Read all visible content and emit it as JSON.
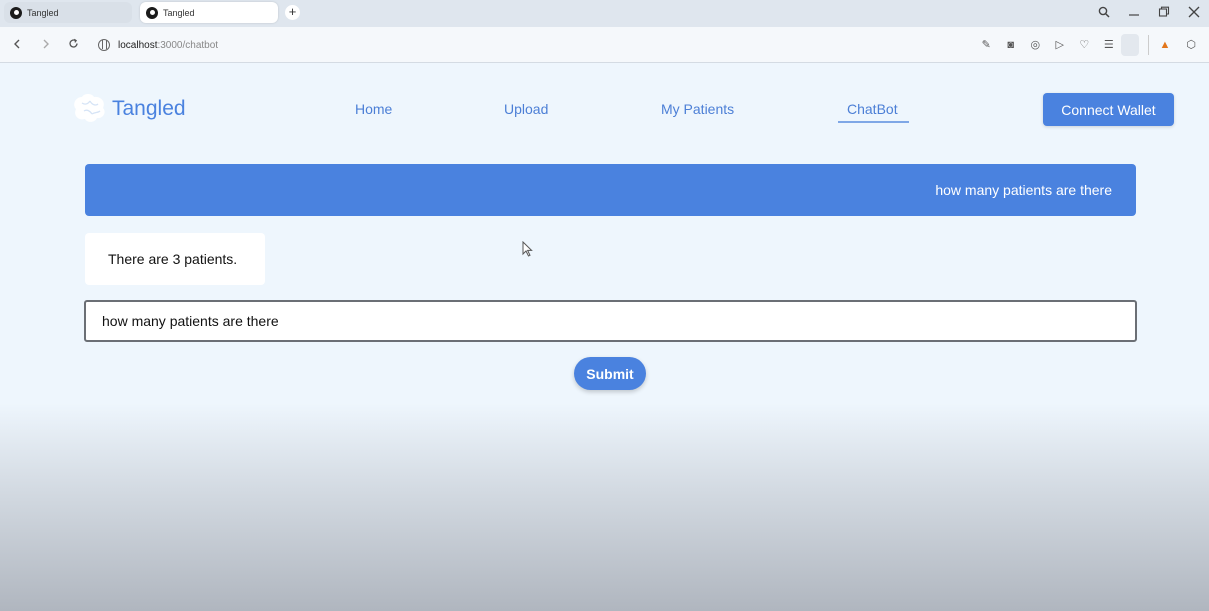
{
  "browser": {
    "tabs": [
      {
        "title": "Tangled",
        "active": false
      },
      {
        "title": "Tangled",
        "active": true
      }
    ],
    "new_tab_glyph": "+",
    "url_host": "localhost",
    "url_path": ":3000/chatbot",
    "window_controls": [
      "search-icon",
      "minimize-icon",
      "restore-icon",
      "close-icon"
    ]
  },
  "app": {
    "brand": "Tangled",
    "nav": {
      "home": "Home",
      "upload": "Upload",
      "my_patients": "My Patients",
      "chatbot": "ChatBot",
      "active": "chatbot"
    },
    "connect_wallet_label": "Connect Wallet"
  },
  "chat": {
    "messages": [
      {
        "role": "user",
        "text": "how many patients are there"
      },
      {
        "role": "bot",
        "text": "There are 3 patients."
      }
    ],
    "input_value": "how many patients are there",
    "submit_label": "Submit"
  },
  "colors": {
    "accent": "#4a82df",
    "page_background": "#eef6fd",
    "bot_bubble": "#ffffff"
  }
}
